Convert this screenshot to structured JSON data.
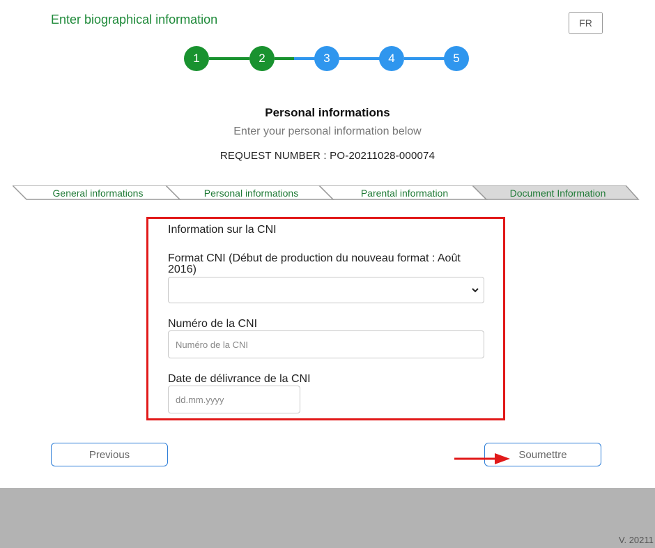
{
  "header": {
    "title": "Enter biographical information",
    "lang_button": "FR"
  },
  "stepper": {
    "steps": [
      "1",
      "2",
      "3",
      "4",
      "5"
    ],
    "completed_steps": 2,
    "colors": {
      "done": "#19922f",
      "todo": "#2f96ee"
    }
  },
  "section": {
    "title": "Personal informations",
    "subtitle": "Enter your personal information below",
    "request_number": "REQUEST NUMBER : PO-20211028-000074"
  },
  "tabs": [
    {
      "label": "General informations",
      "active": false
    },
    {
      "label": "Personal informations",
      "active": false
    },
    {
      "label": "Parental information",
      "active": false
    },
    {
      "label": "Document Information",
      "active": true
    }
  ],
  "form": {
    "heading": "Information sur la CNI",
    "format_label": "Format CNI (Début de production du nouveau format : Août 2016)",
    "format_value": "",
    "number_label": "Numéro de la CNI",
    "number_placeholder": "Numéro de la CNI",
    "date_label": "Date de délivrance de la CNI",
    "date_placeholder": "dd.mm.yyyy"
  },
  "actions": {
    "previous": "Previous",
    "submit": "Soumettre"
  },
  "footer": {
    "version": "V. 20211"
  }
}
